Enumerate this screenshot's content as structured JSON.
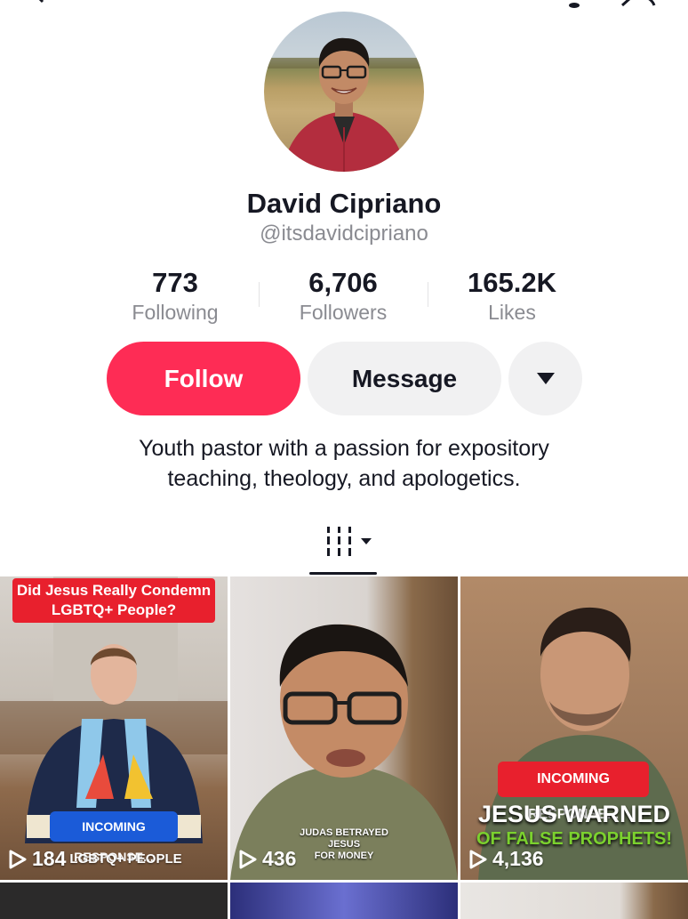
{
  "profile": {
    "name": "David Cipriano",
    "handle": "@itsdavidcipriano",
    "bio_line1": "Youth pastor with a passion for expository",
    "bio_line2": "teaching, theology, and apologetics."
  },
  "stats": [
    {
      "value": "773",
      "label": "Following"
    },
    {
      "value": "6,706",
      "label": "Followers"
    },
    {
      "value": "165.2K",
      "label": "Likes"
    }
  ],
  "actions": {
    "follow_label": "Follow",
    "message_label": "Message"
  },
  "colors": {
    "accent": "#fe2c55",
    "secondary_button": "#f1f1f2",
    "muted_text": "#8a8b91"
  },
  "videos": [
    {
      "views": "184",
      "title_line1": "Did Jesus Really Condemn",
      "title_line2": "LGBTQ+ People?",
      "badge": "INCOMING RESPONSE...",
      "caption": "LGBTQ+ PEOPLE"
    },
    {
      "views": "436",
      "caption_line1": "JUDAS BETRAYED JESUS",
      "caption_line2": "FOR MONEY"
    },
    {
      "views": "4,136",
      "badge": "INCOMING RESPONSE...",
      "headline_line1": "JESUS WARNED",
      "headline_line2": "OF FALSE PROPHETS!"
    }
  ]
}
